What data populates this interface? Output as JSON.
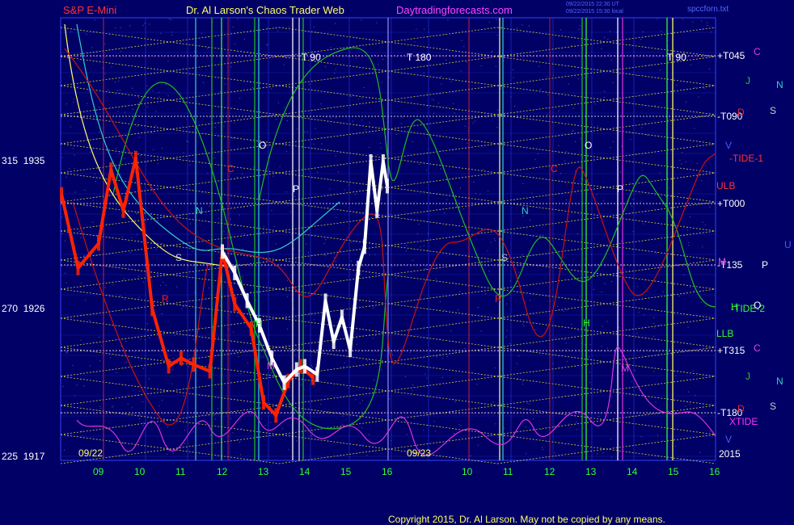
{
  "header": {
    "left": "S&P E-Mini",
    "center": "Dr. Al Larson's Chaos Trader Web",
    "site": "Daytradingforecasts.com",
    "stamp1": "09/22/2015 22:30 UT",
    "stamp2": "09/22/2015 15:30 local",
    "file": "spccforn.txt"
  },
  "footer": {
    "copyright": "Copyright 2015, Dr. Al Larson. May not be copied by any means."
  },
  "colors": {
    "background": "#000066",
    "grid": "#3344ff",
    "yellow": "#ffff33",
    "price": "#ff2200",
    "price_today": "#ffffff",
    "red_line": "#cc1111",
    "green_line": "#22bb22",
    "cyan_line": "#33cccc",
    "magenta_line": "#dd33dd",
    "orange_text": "#ff6600"
  },
  "left_axis": [
    {
      "label": "315  1935"
    },
    {
      "label": "270  1926"
    },
    {
      "label": "225  1917"
    }
  ],
  "date_labels": {
    "left": "09/22",
    "right": "09/23",
    "year": "2015"
  },
  "hour_ticks_left": [
    "09",
    "10",
    "11",
    "12",
    "13",
    "14",
    "15",
    "16"
  ],
  "hour_ticks_right": [
    "10",
    "11",
    "12",
    "13",
    "14",
    "15",
    "16"
  ],
  "right_labels": [
    {
      "text": "+T045",
      "color": "#ffffff"
    },
    {
      "text": "-T090",
      "color": "#ffffff"
    },
    {
      "text": "-TIDE-1",
      "color": "#ff3333"
    },
    {
      "text": "ULB",
      "color": "#ff3333"
    },
    {
      "text": "+T000",
      "color": "#ffffff"
    },
    {
      "text": "-T135",
      "color": "#ffffff"
    },
    {
      "text": "-TIDE-2",
      "color": "#33ff33"
    },
    {
      "text": "LLB",
      "color": "#33ff33"
    },
    {
      "text": "+T315",
      "color": "#ffffff"
    },
    {
      "text": "-T180",
      "color": "#ffffff"
    },
    {
      "text": "XTIDE",
      "color": "#ff33ff"
    }
  ],
  "planet_labels": [
    {
      "text": "C",
      "color": "#dd44dd"
    },
    {
      "text": "J",
      "color": "#22cc22"
    },
    {
      "text": "N",
      "color": "#33cccc"
    },
    {
      "text": "S",
      "color": "#cccccc"
    },
    {
      "text": "D",
      "color": "#ee2222"
    },
    {
      "text": "V",
      "color": "#5555ff"
    },
    {
      "text": "U",
      "color": "#5555ff"
    },
    {
      "text": "P",
      "color": "#ffffff"
    },
    {
      "text": "O",
      "color": "#ffffff"
    },
    {
      "text": "C",
      "color": "#dd44dd"
    },
    {
      "text": "J",
      "color": "#22cc22"
    },
    {
      "text": "N",
      "color": "#33cccc"
    },
    {
      "text": "S",
      "color": "#cccccc"
    },
    {
      "text": "D",
      "color": "#ee2222"
    },
    {
      "text": "V",
      "color": "#5555ff"
    },
    {
      "text": "H",
      "color": "#33ff33"
    },
    {
      "text": "M",
      "color": "#dd44dd"
    }
  ],
  "in_chart_labels": [
    {
      "text": "T   90",
      "color": "#ffffff"
    },
    {
      "text": "T   180",
      "color": "#ffffff"
    },
    {
      "text": "T   90",
      "color": "#ffffff"
    },
    {
      "text": "O",
      "color": "#ffffff"
    },
    {
      "text": "O",
      "color": "#ffffff"
    },
    {
      "text": "P",
      "color": "#ffffff"
    },
    {
      "text": "P",
      "color": "#ffffff"
    },
    {
      "text": "N",
      "color": "#33cccc"
    },
    {
      "text": "N",
      "color": "#33cccc"
    },
    {
      "text": "C",
      "color": "#ee2222"
    },
    {
      "text": "C",
      "color": "#ee2222"
    },
    {
      "text": "S",
      "color": "#cccccc"
    },
    {
      "text": "S",
      "color": "#cccccc"
    },
    {
      "text": "H",
      "color": "#33ff33"
    },
    {
      "text": "H",
      "color": "#33ff33"
    },
    {
      "text": "R",
      "color": "#ee2222"
    },
    {
      "text": "R",
      "color": "#ee2222"
    },
    {
      "text": "M",
      "color": "#dd44dd"
    },
    {
      "text": "M",
      "color": "#dd44dd"
    }
  ],
  "chart_data": {
    "type": "line",
    "title": "S&P E-Mini",
    "y_axis": {
      "price_ticks": [
        1935,
        1926,
        1917
      ],
      "degree_ticks": [
        315,
        270,
        225
      ],
      "ylim": [
        1917,
        1935
      ]
    },
    "x_axis": {
      "days": [
        "09/22",
        "09/23"
      ],
      "hours": [
        9,
        10,
        11,
        12,
        13,
        14,
        15,
        16
      ]
    },
    "series": [
      {
        "name": "",
        "kind": "price_history",
        "x": [
          8.1,
          8.5,
          9.0,
          9.3,
          9.6,
          9.9,
          10.3,
          10.7,
          11.0,
          11.3,
          11.7,
          12.0,
          12.3,
          12.7,
          13.0,
          13.3,
          13.6,
          13.9,
          14.2
        ],
        "y": [
          1933,
          1928.5,
          1930,
          1934.5,
          1932,
          1935.2,
          1926,
          1922.5,
          1923,
          1922.6,
          1922.2,
          1929.5,
          1926.3,
          1924.8,
          1920.3,
          1919.5,
          1921.6,
          1922.5,
          1921.8
        ]
      },
      {
        "name": "",
        "kind": "price_today",
        "x": [
          12.0,
          12.3,
          12.6,
          12.9,
          13.2,
          13.5,
          13.8,
          14.0,
          14.3,
          14.5,
          14.7,
          14.9,
          15.1,
          15.3,
          15.45,
          15.6,
          15.75,
          15.9,
          16.0
        ],
        "y": [
          1929.5,
          1928.2,
          1926.5,
          1925,
          1923,
          1921.5,
          1922.3,
          1922.5,
          1922.0,
          1926.5,
          1924,
          1925.5,
          1923.5,
          1928.5,
          1929.8,
          1935,
          1932,
          1935,
          1933.5
        ]
      }
    ]
  }
}
